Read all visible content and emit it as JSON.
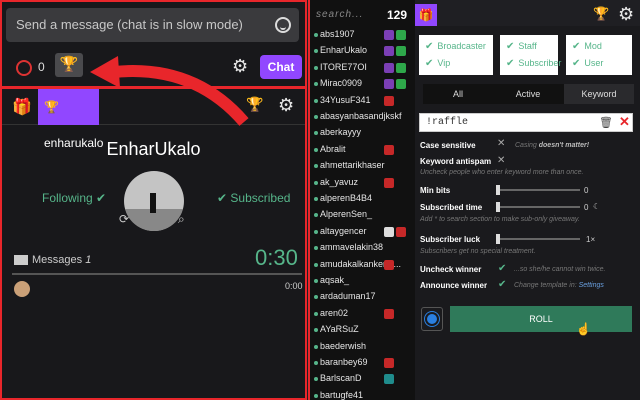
{
  "chat": {
    "placeholder": "Send a message (chat is in slow mode)",
    "points": "0",
    "chat_button": "Chat"
  },
  "raffle_tab": {
    "label": "enharukalo"
  },
  "winner": {
    "name": "EnharUkalo",
    "following": "Following",
    "subscribed": "Subscribed",
    "messages_label": "Messages",
    "messages_count": "1",
    "timer": "0:30",
    "message_time": "0:00",
    "timer_progress": 0.0
  },
  "userlist": {
    "search_placeholder": "search...",
    "count": "129",
    "users": [
      {
        "name": "abs1907",
        "badges": [
          "ext",
          "mod"
        ]
      },
      {
        "name": "EnharUkalo",
        "badges": [
          "ext",
          "mod"
        ]
      },
      {
        "name": "ITORE77OI",
        "badges": [
          "ext",
          "mod"
        ]
      },
      {
        "name": "Mirac0909",
        "badges": [
          "ext",
          "mod"
        ]
      },
      {
        "name": "34YusuF341",
        "badges": [
          "red"
        ]
      },
      {
        "name": "abasyanbasandjkskf",
        "badges": []
      },
      {
        "name": "aberkayyy",
        "badges": []
      },
      {
        "name": "Abralit",
        "badges": [
          "red"
        ]
      },
      {
        "name": "ahmettarikhaser",
        "badges": []
      },
      {
        "name": "ak_yavuz",
        "badges": [
          "red"
        ]
      },
      {
        "name": "alperenB4B4",
        "badges": []
      },
      {
        "name": "AlperenSen_",
        "badges": []
      },
      {
        "name": "altaygencer",
        "badges": [
          "white",
          "red"
        ]
      },
      {
        "name": "ammavelakin38",
        "badges": []
      },
      {
        "name": "amudakalkankerte...",
        "badges": [
          "red"
        ]
      },
      {
        "name": "aqsak_",
        "badges": []
      },
      {
        "name": "ardaduman17",
        "badges": []
      },
      {
        "name": "aren02",
        "badges": [
          "red"
        ]
      },
      {
        "name": "AYaRSuZ",
        "badges": []
      },
      {
        "name": "baederwish",
        "badges": []
      },
      {
        "name": "baranbey69",
        "badges": [
          "red"
        ]
      },
      {
        "name": "BarlscanD",
        "badges": [
          "teal"
        ]
      },
      {
        "name": "bartugfe41",
        "badges": []
      }
    ]
  },
  "filters": {
    "col1": [
      "Broadcaster",
      "Vip"
    ],
    "col2": [
      "Staff",
      "Subscriber"
    ],
    "col3": [
      "Mod",
      "User"
    ]
  },
  "modes": {
    "all": "All",
    "active": "Active",
    "keyword": "Keyword"
  },
  "keyword": {
    "value": "!raffle"
  },
  "options": {
    "case_sensitive": "Case sensitive",
    "case_hint_1": "Casing",
    "case_hint_2": "doesn't matter!",
    "keyword_antispam": "Keyword antispam",
    "antispam_hint": "Uncheck people who enter keyword more than once.",
    "min_bits": "Min bits",
    "min_bits_value": "0",
    "subscribed_time": "Subscribed time",
    "subscribed_time_value": "0",
    "subscribed_hint": "Add * to search section to make sub-only giveaway.",
    "subscriber_luck": "Subscriber luck",
    "subscriber_luck_value": "1×",
    "luck_hint": "Subscribers get no special treatment.",
    "uncheck_winner": "Uncheck winner",
    "uncheck_hint": "...so she/he cannot win twice.",
    "announce_winner": "Announce winner",
    "announce_hint": "Change template in:",
    "announce_link": "Settings"
  },
  "roll": {
    "label": "ROLL"
  },
  "colors": {
    "accent": "#9147ff",
    "green": "#56b58a",
    "red_border": "#e8262b",
    "roll_green": "#2f7a5a"
  }
}
